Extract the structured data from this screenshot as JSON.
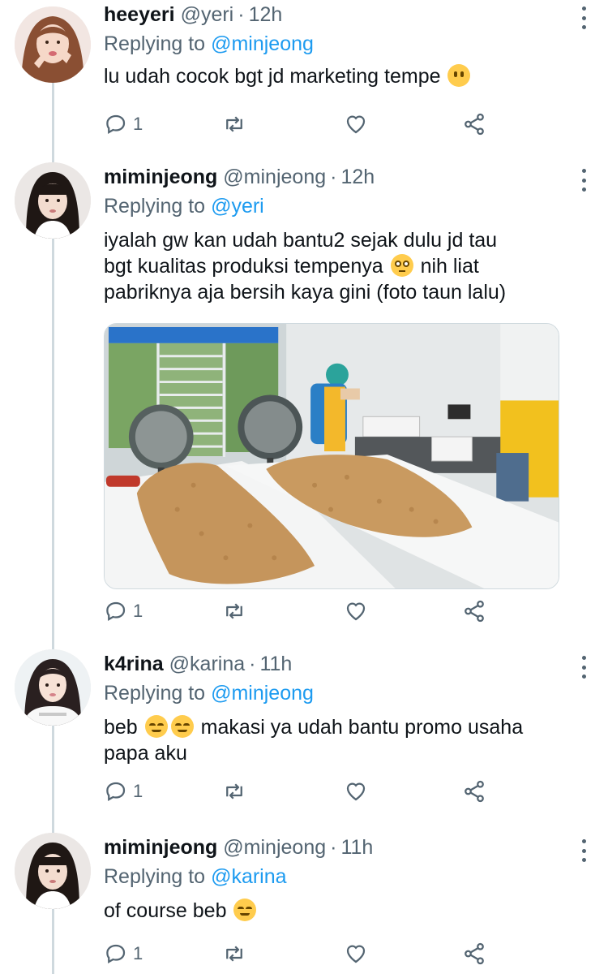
{
  "thread": {
    "tweets": [
      {
        "name": "heeyeri",
        "handle": "@yeri",
        "time": "12h",
        "replying_label": "Replying to",
        "replying_to": "@minjeong",
        "text": "lu udah cocok bgt jd marketing tempe",
        "emoji": "face-without-mouth",
        "reply_count": "1"
      },
      {
        "name": "miminjeong",
        "handle": "@minjeong",
        "time": "12h",
        "replying_label": "Replying to",
        "replying_to": "@yeri",
        "text_line1": "iyalah gw kan udah bantu2 sejak dulu jd tau",
        "text_line2a": "bgt kualitas produksi tempenya",
        "text_line2b": "nih liat",
        "text_line3": "pabriknya aja bersih kaya gini (foto taun lalu)",
        "emoji": "flushed-face",
        "photo": "tempeh-factory-photo",
        "reply_count": "1"
      },
      {
        "name": "k4rina",
        "handle": "@karina",
        "time": "11h",
        "replying_label": "Replying to",
        "replying_to": "@minjeong",
        "text_a": "beb",
        "text_b": "makasi ya udah bantu promo usaha",
        "text_line2": "papa aku",
        "emoji": "relieved-face",
        "reply_count": "1"
      },
      {
        "name": "miminjeong",
        "handle": "@minjeong",
        "time": "11h",
        "replying_label": "Replying to",
        "replying_to": "@karina",
        "text": "of course beb",
        "emoji": "smiling-face",
        "reply_count": "1"
      }
    ],
    "separator": "·"
  },
  "icons": {
    "reply": "reply-icon",
    "retweet": "retweet-icon",
    "like": "heart-icon",
    "share": "share-icon",
    "more": "more-options-icon"
  },
  "colors": {
    "link": "#1d9bf0",
    "secondary_text": "#536471",
    "thread_line": "#cfd9de",
    "emoji": "#ffcc4d"
  }
}
